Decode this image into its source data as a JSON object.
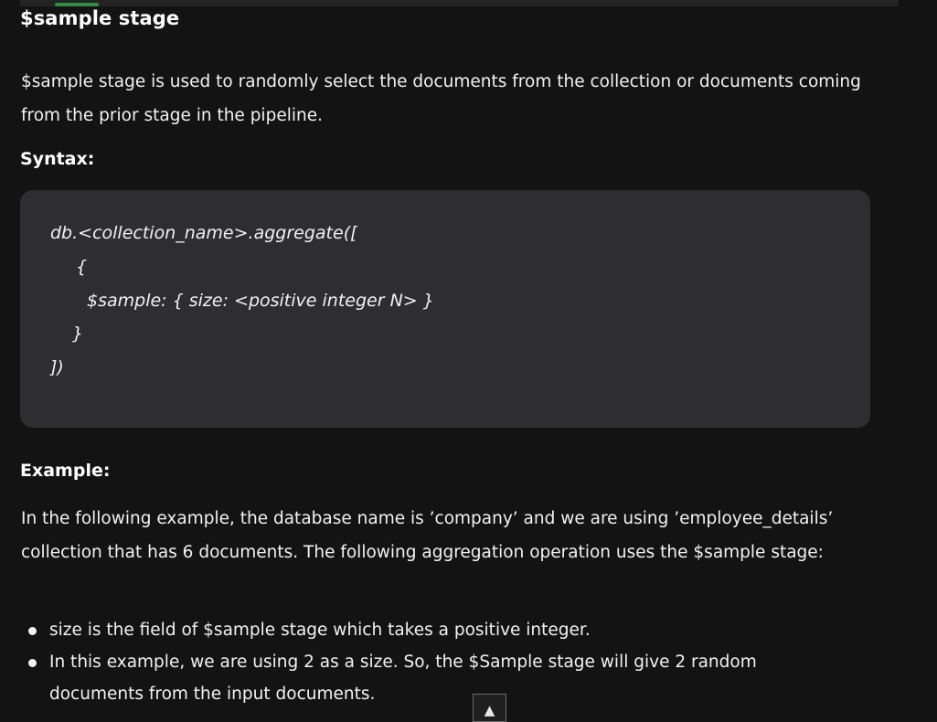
{
  "section": {
    "title": "$sample stage"
  },
  "intro": {
    "text": "$sample stage is used to randomly select the documents from the collection or documents coming from the prior stage in the pipeline."
  },
  "syntax": {
    "label": "Syntax:",
    "code_lines": [
      "db.<collection_name>.aggregate([",
      "{",
      "$sample: { size: <positive integer N> }",
      "}",
      "])"
    ]
  },
  "example": {
    "label": "Example:",
    "text": "In the following example, the database name is ’company’ and we are using ’employee_details’ collection that has 6 documents. The following aggregation operation uses the $sample stage:",
    "bullets": [
      "size is the field of $sample stage which takes a positive integer.",
      "In this example, we are using 2 as a size. So, the $Sample stage will give 2 random documents from the input documents."
    ]
  },
  "scroll_top": {
    "icon": "▲"
  },
  "colors": {
    "background": "#131313",
    "code_background": "#2e2e30",
    "accent": "#2f8d46"
  }
}
